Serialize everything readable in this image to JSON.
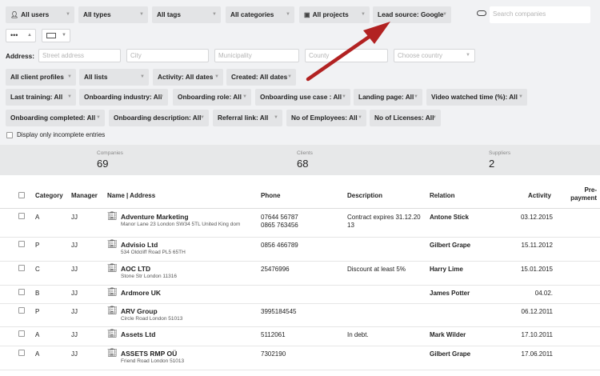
{
  "filters": {
    "row1": [
      {
        "label": "All users",
        "icon": "user-icon"
      },
      {
        "label": "All types"
      },
      {
        "label": "All tags"
      },
      {
        "label": "All categories"
      },
      {
        "label": "All projects",
        "icon": "briefcase-icon"
      },
      {
        "label": "Lead source: Google"
      }
    ],
    "search_placeholder": "Search companies",
    "address_label": "Address:",
    "street_placeholder": "Street address",
    "city_placeholder": "City",
    "municipality_placeholder": "Municipality",
    "county_placeholder": "County",
    "country_placeholder": "Choose country",
    "row3": [
      "All client profiles",
      "All lists",
      "Activity: All dates",
      "Created: All dates"
    ],
    "row4": [
      "Last training: All",
      "Onboarding industry: All",
      "Onboarding role: All",
      "Onboarding use case : All",
      "Landing page: All",
      "Video watched time (%): All"
    ],
    "row5": [
      "Onboarding completed: All",
      "Onboarding description: All",
      "Referral link: All",
      "No of Employees: All",
      "No of Licenses: All"
    ],
    "incomplete_label": "Display only incomplete entries",
    "more_label": "•••"
  },
  "stats": [
    {
      "label": "Companies",
      "value": "69"
    },
    {
      "label": "Clients",
      "value": "68"
    },
    {
      "label": "Suppliers",
      "value": "2"
    }
  ],
  "table": {
    "headers": {
      "category": "Category",
      "manager": "Manager",
      "name": "Name | Address",
      "phone": "Phone",
      "description": "Description",
      "relation": "Relation",
      "activity": "Activity",
      "prepayment": "Pre-payment"
    },
    "rows": [
      {
        "category": "A",
        "manager": "JJ",
        "name": "Adventure Marketing",
        "address": "Manor Lane 23 London SW34 5TL United King dom",
        "phone": "07644 56787\n0865 763456",
        "description": "Contract expires 31.12.20 13",
        "relation": "Antone Stick",
        "activity": "03.12.2015"
      },
      {
        "category": "P",
        "manager": "JJ",
        "name": "Advisio Ltd",
        "address": "534 Oldcliff Road PL5 65TH",
        "phone": "0856 466789",
        "description": "",
        "relation": "Gilbert Grape",
        "activity": "15.11.2012"
      },
      {
        "category": "C",
        "manager": "JJ",
        "name": "AOC LTD",
        "address": "Stone Str London 11316",
        "phone": "25476996",
        "description": "Discount at least 5%",
        "relation": "Harry Lime",
        "activity": "15.01.2015"
      },
      {
        "category": "B",
        "manager": "JJ",
        "name": "Ardmore UK",
        "address": "",
        "phone": "",
        "description": "",
        "relation": "James Potter",
        "activity": "04.02."
      },
      {
        "category": "P",
        "manager": "JJ",
        "name": "ARV Group",
        "address": "Circle Road London 51013",
        "phone": "3995184545",
        "description": "",
        "relation": "",
        "activity": "06.12.2011"
      },
      {
        "category": "A",
        "manager": "JJ",
        "name": "Assets Ltd",
        "address": "",
        "phone": "5112061",
        "description": "In debt.",
        "relation": "Mark Wilder",
        "activity": "17.10.2011"
      },
      {
        "category": "A",
        "manager": "JJ",
        "name": "ASSETS RMP OÜ",
        "address": "Friend Road London 51013",
        "phone": "7302190",
        "description": "",
        "relation": "Gilbert Grape",
        "activity": "17.06.2011"
      }
    ]
  },
  "colors": {
    "arrow": "#b22222",
    "filter_bg": "#f1f2f4",
    "stats_bg": "#e7e8e9"
  }
}
